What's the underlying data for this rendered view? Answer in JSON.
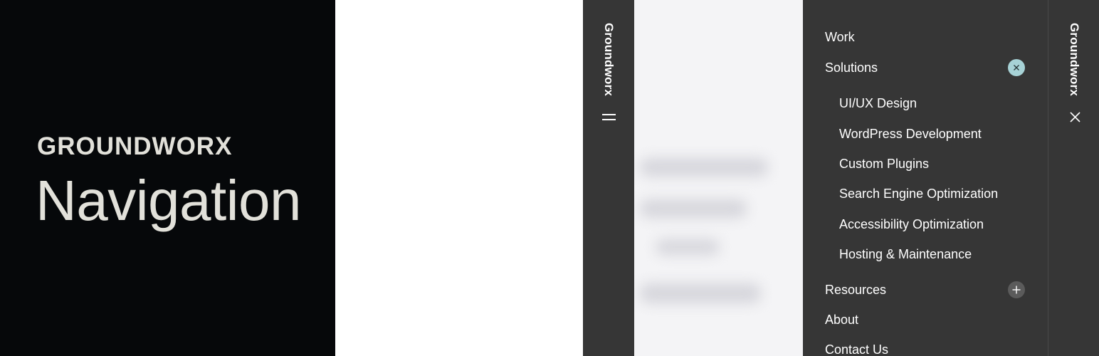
{
  "hero": {
    "eyebrow": "GROUNDWORX",
    "title": "Navigation"
  },
  "collapsed_rail": {
    "brand": "Groundworx",
    "menu_icon": "hamburger-icon"
  },
  "expanded_rail": {
    "brand": "Groundworx",
    "close_icon": "close-icon"
  },
  "menu": {
    "items": [
      {
        "label": "Work"
      },
      {
        "label": "Solutions",
        "toggle": "close-circle-icon",
        "expanded": true,
        "children": [
          {
            "label": "UI/UX Design"
          },
          {
            "label": "WordPress Development"
          },
          {
            "label": "Custom Plugins"
          },
          {
            "label": "Search Engine Optimization"
          },
          {
            "label": "Accessibility Optimization"
          },
          {
            "label": "Hosting & Maintenance"
          }
        ]
      },
      {
        "label": "Resources",
        "toggle": "plus-circle-icon",
        "expanded": false
      },
      {
        "label": "About"
      },
      {
        "label": "Contact Us"
      }
    ]
  },
  "colors": {
    "hero_bg": "#06080a",
    "hero_text": "#e2e1da",
    "panel_bg": "#363636",
    "accent_toggle": "#a7d2d6",
    "toggle_muted": "#5b5b5b",
    "preview_bg": "#f4f4f6"
  }
}
